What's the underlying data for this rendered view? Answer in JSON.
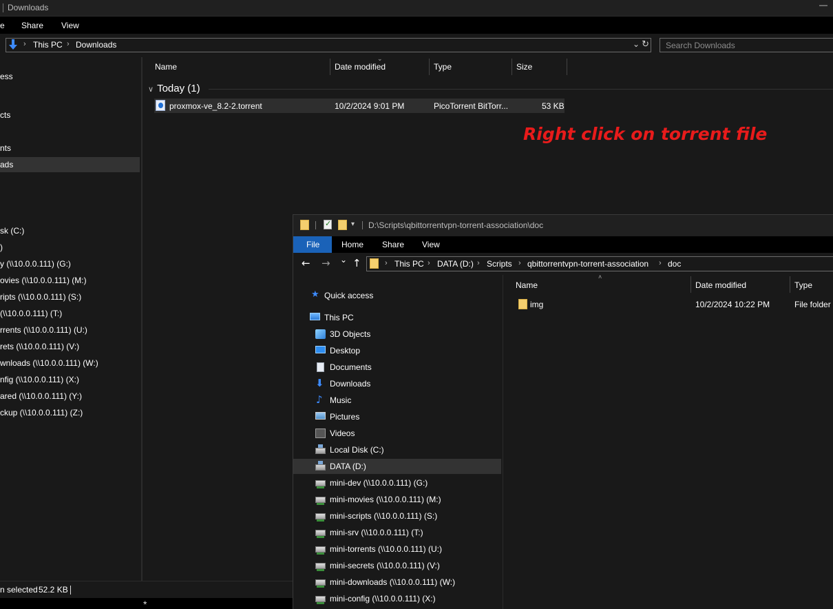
{
  "back_window": {
    "title": "Downloads",
    "minimize_glyph": "—",
    "ribbon_tabs": [
      "e",
      "Share",
      "View"
    ],
    "breadcrumb": [
      "This PC",
      "Downloads"
    ],
    "search_placeholder": "Search Downloads",
    "nav_items": [
      {
        "label": "ess"
      },
      {
        "label": "cts"
      },
      {
        "label": "nts"
      },
      {
        "label": "ads",
        "selected": true
      },
      {
        "label": "sk (C:)"
      },
      {
        "label": ")"
      },
      {
        "label": "y (\\\\10.0.0.111) (G:)"
      },
      {
        "label": "ovies (\\\\10.0.0.111) (M:)"
      },
      {
        "label": "ripts (\\\\10.0.0.111) (S:)"
      },
      {
        "label": "(\\\\10.0.0.111) (T:)"
      },
      {
        "label": "rrents (\\\\10.0.0.111) (U:)"
      },
      {
        "label": "rets (\\\\10.0.0.111) (V:)"
      },
      {
        "label": "wnloads (\\\\10.0.0.111) (W:)"
      },
      {
        "label": "nfig (\\\\10.0.0.111) (X:)"
      },
      {
        "label": "ared (\\\\10.0.0.111) (Y:)"
      },
      {
        "label": "ckup (\\\\10.0.0.111) (Z:)"
      }
    ],
    "columns": [
      "Name",
      "Date modified",
      "Type",
      "Size"
    ],
    "group": {
      "label": "Today (1)"
    },
    "files": [
      {
        "name": "proxmox-ve_8.2-2.torrent",
        "date": "10/2/2024 9:01 PM",
        "type": "PicoTorrent BitTorr...",
        "size": "53 KB"
      }
    ],
    "annotation": "Right click on torrent file",
    "status_selected": "n selected",
    "status_size": "52.2 KB",
    "bottom_glyph": "*"
  },
  "front_window": {
    "title_path": "D:\\Scripts\\qbittorrentvpn-torrent-association\\doc",
    "ribbon_tabs": [
      "File",
      "Home",
      "Share",
      "View"
    ],
    "nav_buttons": {
      "back": "←",
      "forward": "→",
      "recent": "⌄",
      "up": "↑"
    },
    "breadcrumb": [
      "This PC",
      "DATA (D:)",
      "Scripts",
      "qbittorrentvpn-torrent-association",
      "doc"
    ],
    "tree": [
      {
        "label": "Quick access",
        "icon": "star-icon"
      },
      {
        "label": "This PC",
        "icon": "computer-icon"
      },
      {
        "label": "3D Objects",
        "icon": "3d-objects-icon"
      },
      {
        "label": "Desktop",
        "icon": "desktop-icon"
      },
      {
        "label": "Documents",
        "icon": "documents-icon"
      },
      {
        "label": "Downloads",
        "icon": "download-arrow-icon"
      },
      {
        "label": "Music",
        "icon": "music-note-icon"
      },
      {
        "label": "Pictures",
        "icon": "pictures-icon"
      },
      {
        "label": "Videos",
        "icon": "videos-icon"
      },
      {
        "label": "Local Disk (C:)",
        "icon": "local-disk-icon"
      },
      {
        "label": "DATA (D:)",
        "icon": "drive-icon",
        "selected": true
      },
      {
        "label": "mini-dev (\\\\10.0.0.111) (G:)",
        "icon": "network-drive-icon"
      },
      {
        "label": "mini-movies (\\\\10.0.0.111) (M:)",
        "icon": "network-drive-icon"
      },
      {
        "label": "mini-scripts (\\\\10.0.0.111) (S:)",
        "icon": "network-drive-icon"
      },
      {
        "label": "mini-srv (\\\\10.0.0.111) (T:)",
        "icon": "network-drive-icon"
      },
      {
        "label": "mini-torrents (\\\\10.0.0.111) (U:)",
        "icon": "network-drive-icon"
      },
      {
        "label": "mini-secrets (\\\\10.0.0.111) (V:)",
        "icon": "network-drive-icon"
      },
      {
        "label": "mini-downloads (\\\\10.0.0.111) (W:)",
        "icon": "network-drive-icon"
      },
      {
        "label": "mini-config (\\\\10.0.0.111) (X:)",
        "icon": "network-drive-icon"
      }
    ],
    "columns": [
      "Name",
      "Date modified",
      "Type"
    ],
    "files": [
      {
        "name": "img",
        "date": "10/2/2024 10:22 PM",
        "type": "File folder"
      }
    ]
  },
  "colors": {
    "accent": "#1a62b8",
    "annotation": "#e81b1b",
    "background": "#191919"
  }
}
